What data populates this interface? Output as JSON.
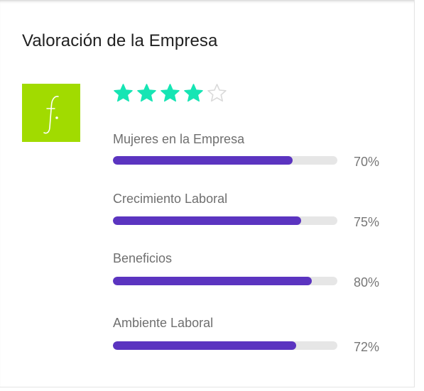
{
  "card": {
    "title": "Valoración de la Empresa"
  },
  "company": {
    "logo_icon": "falabella-f-logo-icon",
    "logo_color": "#a1db00"
  },
  "rating": {
    "value": 4,
    "max": 5,
    "filled_color": "#16e5b4",
    "empty_color": "#d9d9d9"
  },
  "metrics": [
    {
      "label": "Mujeres en la Empresa",
      "value_text": "70%",
      "fill": 0.8
    },
    {
      "label": "Crecimiento Laboral",
      "value_text": "75%",
      "fill": 0.84
    },
    {
      "label": "Beneficios",
      "value_text": "80%",
      "fill": 0.885
    },
    {
      "label": "Ambiente Laboral",
      "value_text": "72%",
      "fill": 0.815
    }
  ],
  "colors": {
    "bar_fill": "#5b34c0",
    "bar_track": "#e6e6e6"
  }
}
